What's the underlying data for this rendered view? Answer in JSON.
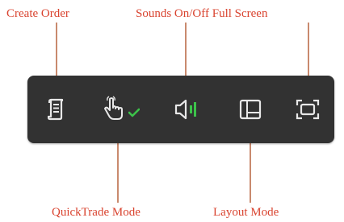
{
  "labels": {
    "create_order": "Create Order",
    "sounds_fullscreen": "Sounds On/Off Full Screen",
    "quicktrade_mode": "QuickTrade Mode",
    "layout_mode": "Layout Mode"
  },
  "toolbar": {
    "buttons": [
      {
        "icon": "create-order-icon"
      },
      {
        "icon": "quicktrade-hand-icon",
        "status": "enabled-checkmark"
      },
      {
        "icon": "sound-on-icon"
      },
      {
        "icon": "layout-mode-icon"
      },
      {
        "icon": "full-screen-icon"
      }
    ]
  },
  "colors": {
    "toolbar_bg": "#323232",
    "icon": "#e8e8e8",
    "active_green": "#3cc24a",
    "label_red": "#d9432f",
    "leader_line": "#c98a6e"
  }
}
